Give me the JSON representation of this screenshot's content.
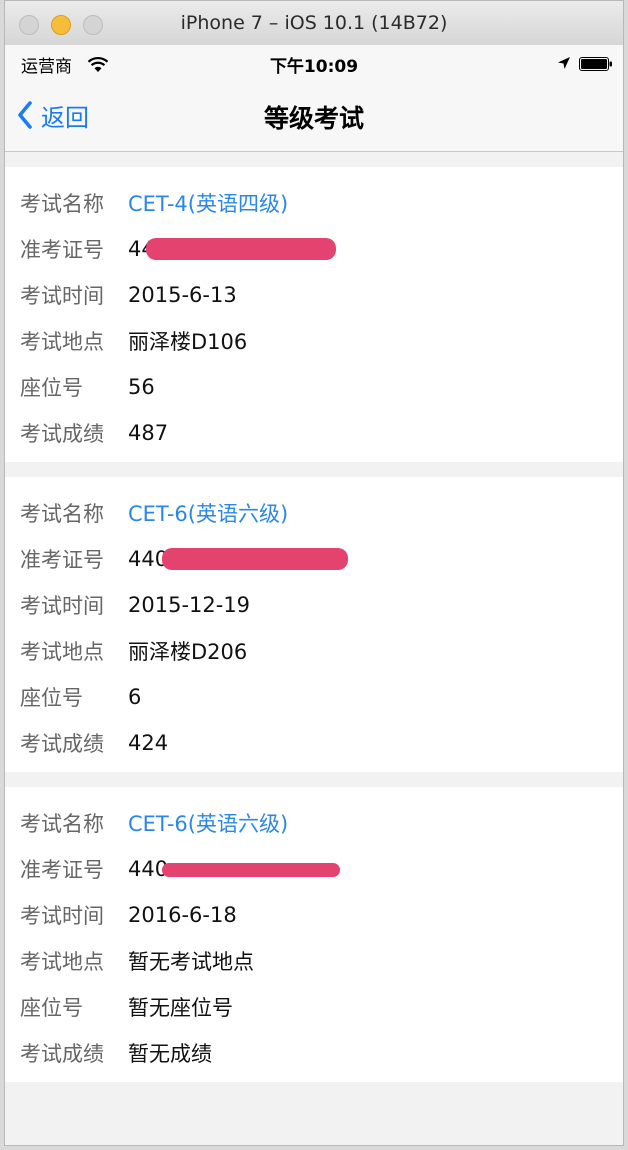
{
  "window": {
    "title": "iPhone 7 – iOS 10.1 (14B72)"
  },
  "status_bar": {
    "carrier": "运营商",
    "time": "下午10:09"
  },
  "nav": {
    "back_label": "返回",
    "title": "等级考试"
  },
  "labels": {
    "exam_name": "考试名称",
    "ticket_no": "准考证号",
    "exam_time": "考试时间",
    "location": "考试地点",
    "seat": "座位号",
    "score": "考试成绩"
  },
  "exams": [
    {
      "name": "CET-4(英语四级)",
      "ticket": "44",
      "time": "2015-6-13",
      "location": "丽泽楼D106",
      "seat": "56",
      "score": "487"
    },
    {
      "name": "CET-6(英语六级)",
      "ticket": "440",
      "time": "2015-12-19",
      "location": "丽泽楼D206",
      "seat": "6",
      "score": "424"
    },
    {
      "name": "CET-6(英语六级)",
      "ticket": "440",
      "time": "2016-6-18",
      "location": "暂无考试地点",
      "seat": "暂无座位号",
      "score": "暂无成绩"
    }
  ]
}
